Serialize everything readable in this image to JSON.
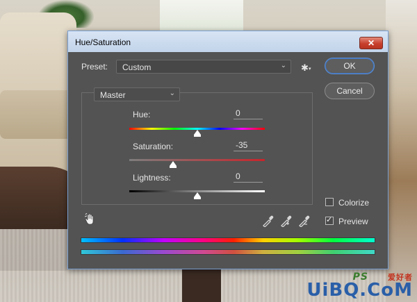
{
  "dialog": {
    "title": "Hue/Saturation",
    "close_glyph": "✕",
    "preset": {
      "label": "Preset:",
      "value": "Custom"
    },
    "buttons": {
      "ok": "OK",
      "cancel": "Cancel"
    },
    "channel": {
      "value": "Master"
    },
    "sliders": [
      {
        "id": "hue",
        "label": "Hue:",
        "value": "0",
        "position_fraction": 0.5
      },
      {
        "id": "saturation",
        "label": "Saturation:",
        "value": "-35",
        "position_fraction": 0.325
      },
      {
        "id": "lightness",
        "label": "Lightness:",
        "value": "0",
        "position_fraction": 0.5
      }
    ],
    "colorize": {
      "label": "Colorize",
      "checked": false
    },
    "preview": {
      "label": "Preview",
      "checked": true
    }
  },
  "icons": {
    "settings": "gear-icon",
    "target_adjust": "hand-icon",
    "eyedroppers": [
      "eyedropper-icon",
      "eyedropper-plus-icon",
      "eyedropper-minus-icon"
    ]
  },
  "watermark": {
    "text": "UiBQ.CoM",
    "ps": "PS",
    "cn": "爱好者"
  },
  "colors": {
    "dialog_bg": "#535353",
    "titlebar": "#c9d8ec",
    "close_button": "#c7402c",
    "ok_border": "#5b8fd6"
  }
}
